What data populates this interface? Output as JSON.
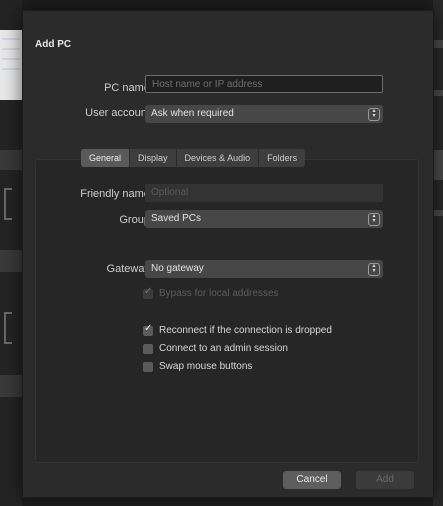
{
  "dialog": {
    "title": "Add PC",
    "pc_name": {
      "label": "PC name:",
      "placeholder": "Host name or IP address"
    },
    "user_account": {
      "label": "User account:",
      "value": "Ask when required"
    },
    "tabs": [
      {
        "label": "General",
        "active": true
      },
      {
        "label": "Display",
        "active": false
      },
      {
        "label": "Devices & Audio",
        "active": false
      },
      {
        "label": "Folders",
        "active": false
      }
    ],
    "friendly_name": {
      "label": "Friendly name:",
      "placeholder": "Optional"
    },
    "group": {
      "label": "Group:",
      "value": "Saved PCs"
    },
    "gateway": {
      "label": "Gateway:",
      "value": "No gateway"
    },
    "checkboxes": {
      "bypass": {
        "label": "Bypass for local addresses",
        "checked": true,
        "enabled": false
      },
      "reconnect": {
        "label": "Reconnect if the connection is dropped",
        "checked": true,
        "enabled": true
      },
      "admin": {
        "label": "Connect to an admin session",
        "checked": false,
        "enabled": true
      },
      "swap": {
        "label": "Swap mouse buttons",
        "checked": false,
        "enabled": true
      }
    },
    "buttons": {
      "cancel": "Cancel",
      "add": "Add"
    }
  }
}
